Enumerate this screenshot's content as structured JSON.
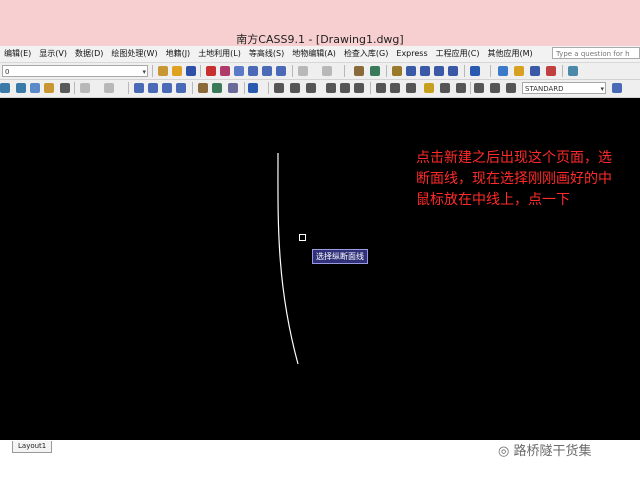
{
  "window": {
    "title": "南方CASS9.1 - [Drawing1.dwg]"
  },
  "menu": {
    "items": [
      "编辑(E)",
      "显示(V)",
      "数据(D)",
      "绘图处理(W)",
      "地籍(J)",
      "土地利用(L)",
      "等高线(S)",
      "地物编辑(A)",
      "检查入库(G)",
      "Express",
      "工程应用(C)",
      "其他应用(M)"
    ],
    "help_placeholder": "Type a question for h"
  },
  "toolbar1": {
    "layer_value": "0"
  },
  "toolbar2": {
    "style_value": "STANDARD"
  },
  "drawing": {
    "annotation_lines": [
      "点击新建之后出现这个页面，选",
      "断面线，现在选择刚刚画好的中",
      "鼠标放在中线上，点一下"
    ],
    "tooltip": "选择纵断面线",
    "background": "#000000",
    "annotation_color": "#ff2a2a"
  },
  "tabs": {
    "layout_tab": "Layout1"
  },
  "watermark": {
    "text": "路桥隧干货集"
  }
}
